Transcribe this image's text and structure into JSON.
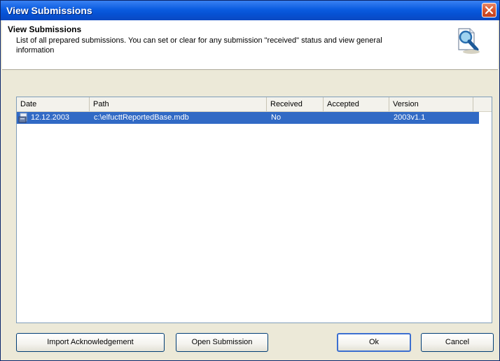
{
  "window": {
    "title": "View Submissions"
  },
  "header": {
    "title": "View Submissions",
    "description": "List of all prepared submissions. You can set or clear for any submission \"received\" status and view general information"
  },
  "list": {
    "columns": [
      "Date",
      "Path",
      "Received",
      "Accepted",
      "Version"
    ],
    "rows": [
      {
        "date": "12.12.2003",
        "path": "c:\\elfucttReportedBase.mdb",
        "received": "No",
        "accepted": "",
        "version": "2003v1.1"
      }
    ]
  },
  "buttons": {
    "import": "Import Acknowledgement",
    "open": "Open Submission",
    "ok": "Ok",
    "cancel": "Cancel"
  },
  "icons": {
    "close": "close-icon",
    "header": "search-document-icon",
    "row": "submission-icon"
  },
  "colors": {
    "titlebar": "#0a5ce0",
    "selection": "#316ac5",
    "face": "#ece9d8"
  }
}
